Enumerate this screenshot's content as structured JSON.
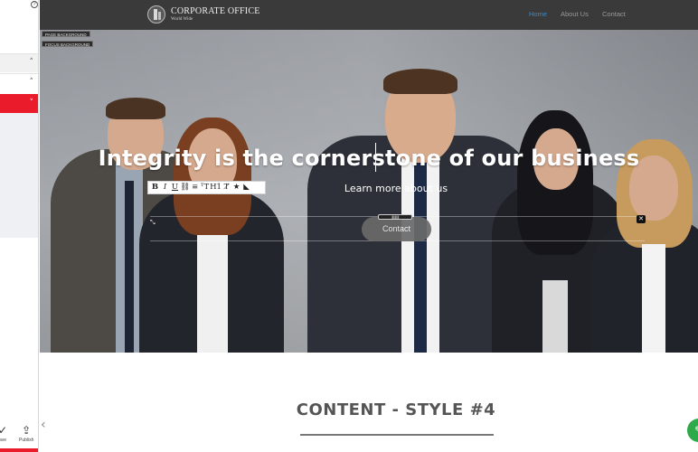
{
  "site": {
    "brand_name": "CORPORATE OFFICE",
    "brand_tagline": "World Wide",
    "nav": [
      {
        "label": "Home",
        "active": true
      },
      {
        "label": "About Us",
        "active": false
      },
      {
        "label": "Contact",
        "active": false
      }
    ]
  },
  "editor": {
    "help_label": "?",
    "badges": {
      "page_background": "PAGE BACKGROUND",
      "focus_background": "FOCUS BACKGROUND"
    },
    "bottom_buttons": [
      {
        "label": "ave",
        "icon": "pencil-icon"
      },
      {
        "label": "Publish",
        "icon": "upload-icon"
      }
    ],
    "accent_color": "#ea1c2c"
  },
  "hero": {
    "title": "Integrity is the cornerstone of our business",
    "subtitle": "Learn more about us",
    "button_label": "Contact"
  },
  "content": {
    "section_title": "CONTENT - STYLE #4"
  }
}
